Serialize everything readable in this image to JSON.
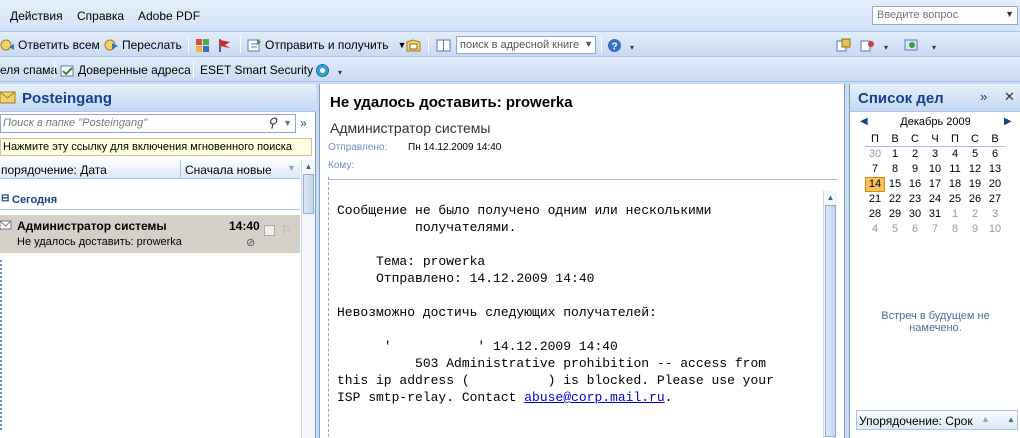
{
  "menu": {
    "actions": "Действия",
    "help": "Справка",
    "adobe": "Adobe PDF",
    "ask_placeholder": "Введите вопрос"
  },
  "toolbar1": {
    "reply_all": "Ответить всем",
    "forward": "Переслать",
    "send_receive": "Отправить и получить",
    "address_search": "поиск в адресной книге"
  },
  "toolbar2": {
    "spam": "еля спама",
    "trusted": "Доверенные адреса",
    "eset": "ESET Smart Security"
  },
  "left": {
    "title": "Posteingang",
    "search_placeholder": "Поиск в папке \"Posteingang\"",
    "instant_link": "Нажмите эту ссылку для включения мгновенного поиска",
    "arrange_by": "порядочение: Дата",
    "sort_order": "Сначала новые",
    "group_today": "Сегодня",
    "message": {
      "sender": "Администратор системы",
      "time": "14:40",
      "subject": "Не удалось доставить: prowerka"
    }
  },
  "reading": {
    "subject": "Не удалось доставить: prowerka",
    "sender": "Администратор системы",
    "sent_label": "Отправлено:",
    "sent_value": "Пн 14.12.2009 14:40",
    "to_label": "Кому:",
    "body": {
      "line1": "Сообщение не было получено одним или несколькими",
      "line2": "          получателями.",
      "line3": "     Тема: prowerka",
      "line4": "     Отправлено: 14.12.2009 14:40",
      "line5": "Невозможно достичь следующих получателей:",
      "line6": "      '           ' 14.12.2009 14:40",
      "line7": "          503 Administrative prohibition -- access from",
      "line8": "this ip address (          ) is blocked. Please use your",
      "line9_prefix": "ISP smtp-relay. Contact ",
      "line9_link": "abuse@corp.mail.ru",
      "line9_suffix": "."
    }
  },
  "todo": {
    "title": "Список дел",
    "month": "Декабрь 2009",
    "weekdays": [
      "П",
      "В",
      "С",
      "Ч",
      "П",
      "С",
      "В"
    ],
    "weeks": [
      [
        "30",
        "1",
        "2",
        "3",
        "4",
        "5",
        "6"
      ],
      [
        "7",
        "8",
        "9",
        "10",
        "11",
        "12",
        "13"
      ],
      [
        "14",
        "15",
        "16",
        "17",
        "18",
        "19",
        "20"
      ],
      [
        "21",
        "22",
        "23",
        "24",
        "25",
        "26",
        "27"
      ],
      [
        "28",
        "29",
        "30",
        "31",
        "1",
        "2",
        "3"
      ],
      [
        "4",
        "5",
        "6",
        "7",
        "8",
        "9",
        "10"
      ]
    ],
    "today": "14",
    "no_meetings": "Встреч в будущем не намечено.",
    "arrange": "Упорядочение: Срок"
  }
}
